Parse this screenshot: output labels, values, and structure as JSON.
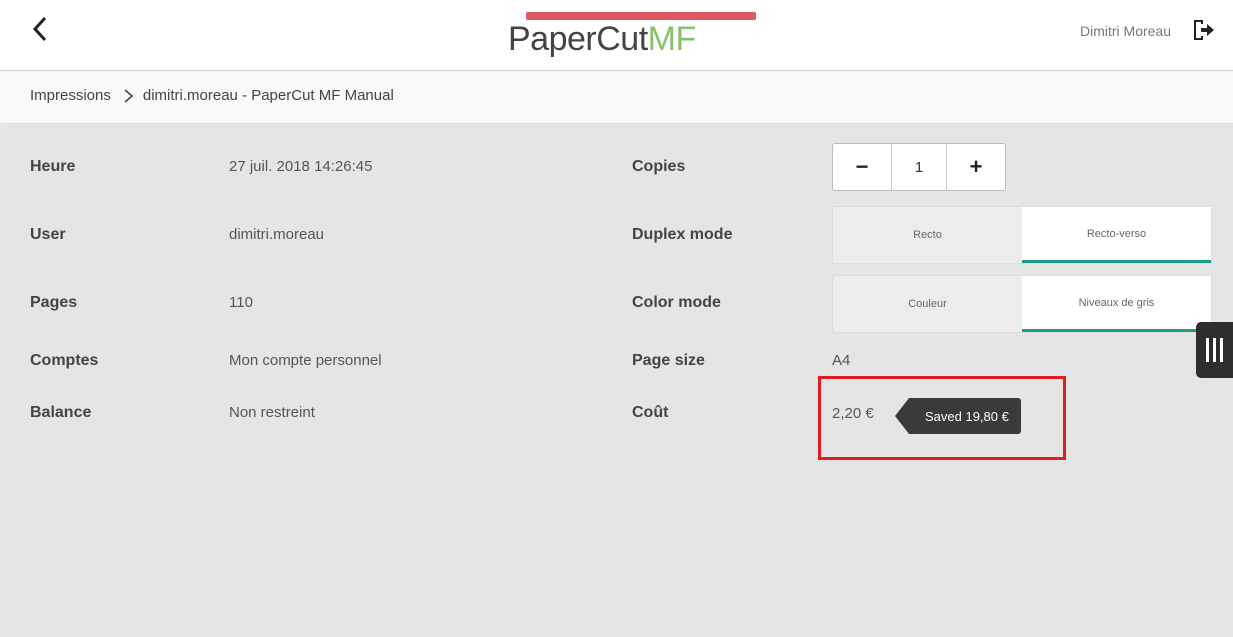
{
  "header": {
    "logo_part1": "PaperCut",
    "logo_part2": "MF",
    "username": "Dimitri Moreau"
  },
  "breadcrumb": {
    "root": "Impressions",
    "current": "dimitri.moreau - PaperCut MF Manual"
  },
  "details": {
    "heure_label": "Heure",
    "heure_value": "27 juil. 2018 14:26:45",
    "user_label": "User",
    "user_value": "dimitri.moreau",
    "pages_label": "Pages",
    "pages_value": "110",
    "comptes_label": "Comptes",
    "comptes_value": "Mon compte personnel",
    "balance_label": "Balance",
    "balance_value": "Non restreint"
  },
  "options": {
    "copies_label": "Copies",
    "copies_minus": "−",
    "copies_value": "1",
    "copies_plus": "+",
    "duplex_label": "Duplex mode",
    "duplex_options": [
      "Recto",
      "Recto-verso"
    ],
    "duplex_selected": "Recto-verso",
    "color_label": "Color mode",
    "color_options": [
      "Couleur",
      "Niveaux de gris"
    ],
    "color_selected": "Niveaux de gris",
    "page_size_label": "Page size",
    "page_size_value": "A4",
    "cost_label": "Coût",
    "cost_value": "2,20 €",
    "saved_text": "Saved 19,80 €"
  },
  "colors": {
    "accent": "#1a9d8b",
    "highlight": "#e02020",
    "logo_green": "#88c06c",
    "logo_red": "#e05561"
  }
}
